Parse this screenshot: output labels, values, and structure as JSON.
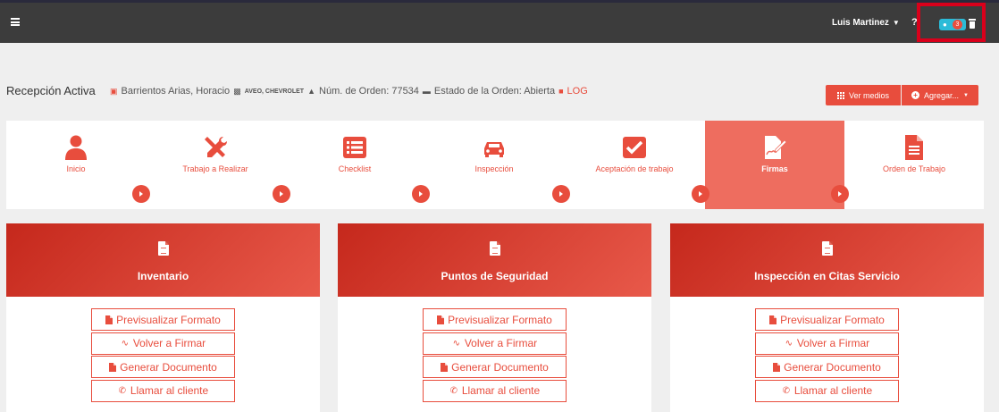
{
  "topbar": {
    "user_name": "Luis Martinez",
    "help_glyph": "?",
    "notification_count": "3",
    "icons": [
      "menu-icon",
      "chevron-down-icon",
      "bell-icon",
      "trash-icon"
    ]
  },
  "header": {
    "title": "Recepción Activa",
    "client": "Barrientos Arias, Horacio",
    "vehicle": "AVEO, CHEVROLET",
    "order_number": "Núm. de Orden: 77534",
    "order_status": "Estado de la Orden: Abierta",
    "log_label": "LOG"
  },
  "buttons": {
    "ver_medios": "Ver medios",
    "agregar": "Agregar..."
  },
  "steps": [
    {
      "label": "Inicio",
      "icon": "user-icon"
    },
    {
      "label": "Trabajo a Realizar",
      "icon": "tools-icon"
    },
    {
      "label": "Checklist",
      "icon": "list-icon"
    },
    {
      "label": "Inspección",
      "icon": "car-icon"
    },
    {
      "label": "Aceptación de trabajo",
      "icon": "check-square-icon"
    },
    {
      "label": "Firmas",
      "icon": "signature-icon",
      "active": true
    },
    {
      "label": "Orden de Trabajo",
      "icon": "file-text-icon"
    }
  ],
  "cards": [
    {
      "title": "Inventario"
    },
    {
      "title": "Puntos de Seguridad"
    },
    {
      "title": "Inspección en Citas Servicio"
    }
  ],
  "card_actions": {
    "preview": "Previsualizar Formato",
    "resign": "Volver a Firmar",
    "generate": "Generar Documento",
    "call": "Llamar al cliente"
  },
  "colors": {
    "accent": "#e84d3d",
    "topbar": "#3c3c3c",
    "active_step": "#ee6d5f",
    "badge_pill": "#2bbbd8",
    "highlight_box": "#d9001b"
  }
}
